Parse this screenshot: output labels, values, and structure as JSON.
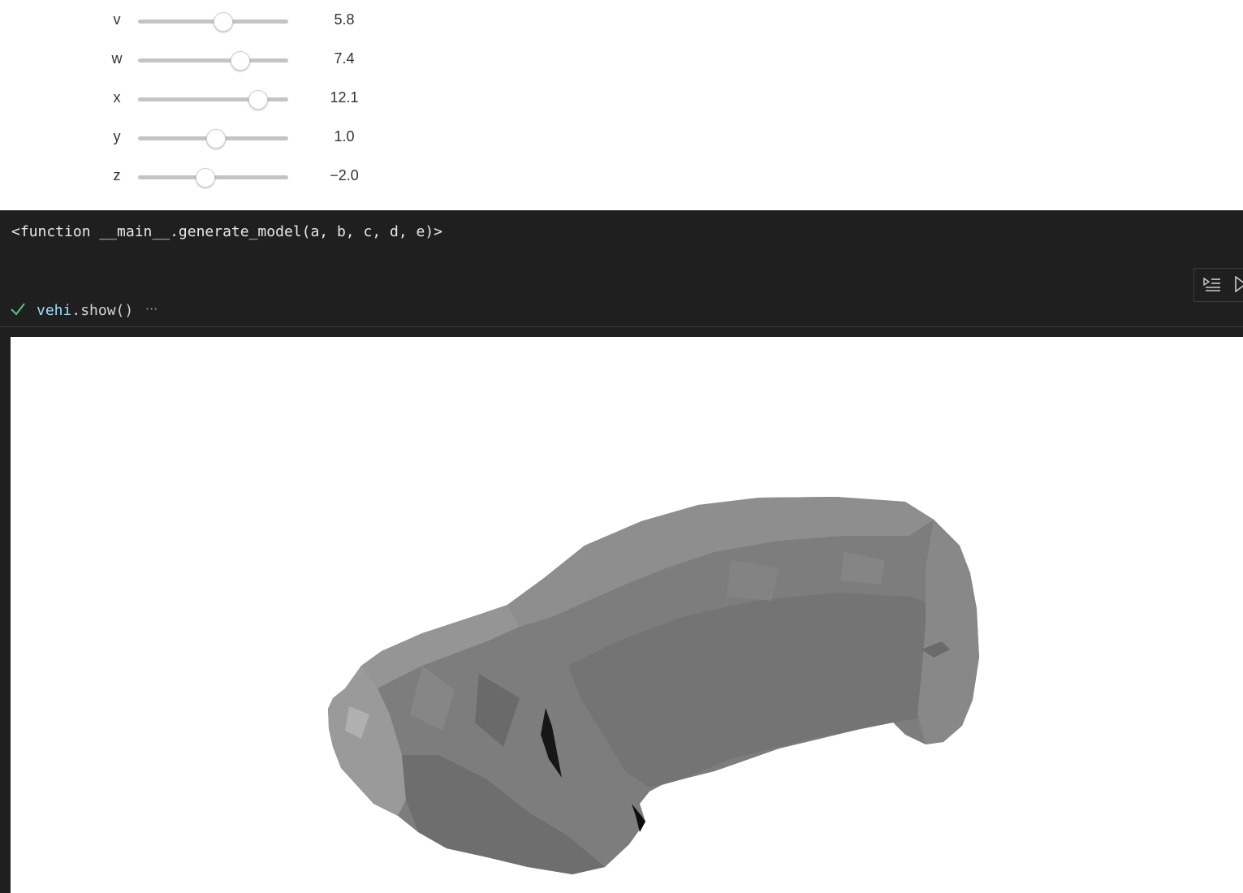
{
  "sliders": [
    {
      "label": "v",
      "value": "5.8",
      "fraction": 0.57
    },
    {
      "label": "w",
      "value": "7.4",
      "fraction": 0.68
    },
    {
      "label": "x",
      "value": "12.1",
      "fraction": 0.8
    },
    {
      "label": "y",
      "value": "1.0",
      "fraction": 0.52
    },
    {
      "label": "z",
      "value": "−2.0",
      "fraction": 0.45
    }
  ],
  "output": {
    "function_repr": "<function __main__.generate_model(a, b, c, d, e)>"
  },
  "cell": {
    "status": "success",
    "code_var": "vehi",
    "code_rest": ".show()",
    "collapsed_indicator": "···"
  },
  "colors": {
    "background_dark": "#1f1f1f",
    "slider_track": "#c4c4c4",
    "check_green": "#4ec97e",
    "code_variable": "#9cdcfe",
    "model_gray": "#7a7a7a"
  },
  "icons": {
    "toolbar": [
      "run-by-line-icon",
      "execute-icon"
    ],
    "status": "checkmark-icon"
  }
}
